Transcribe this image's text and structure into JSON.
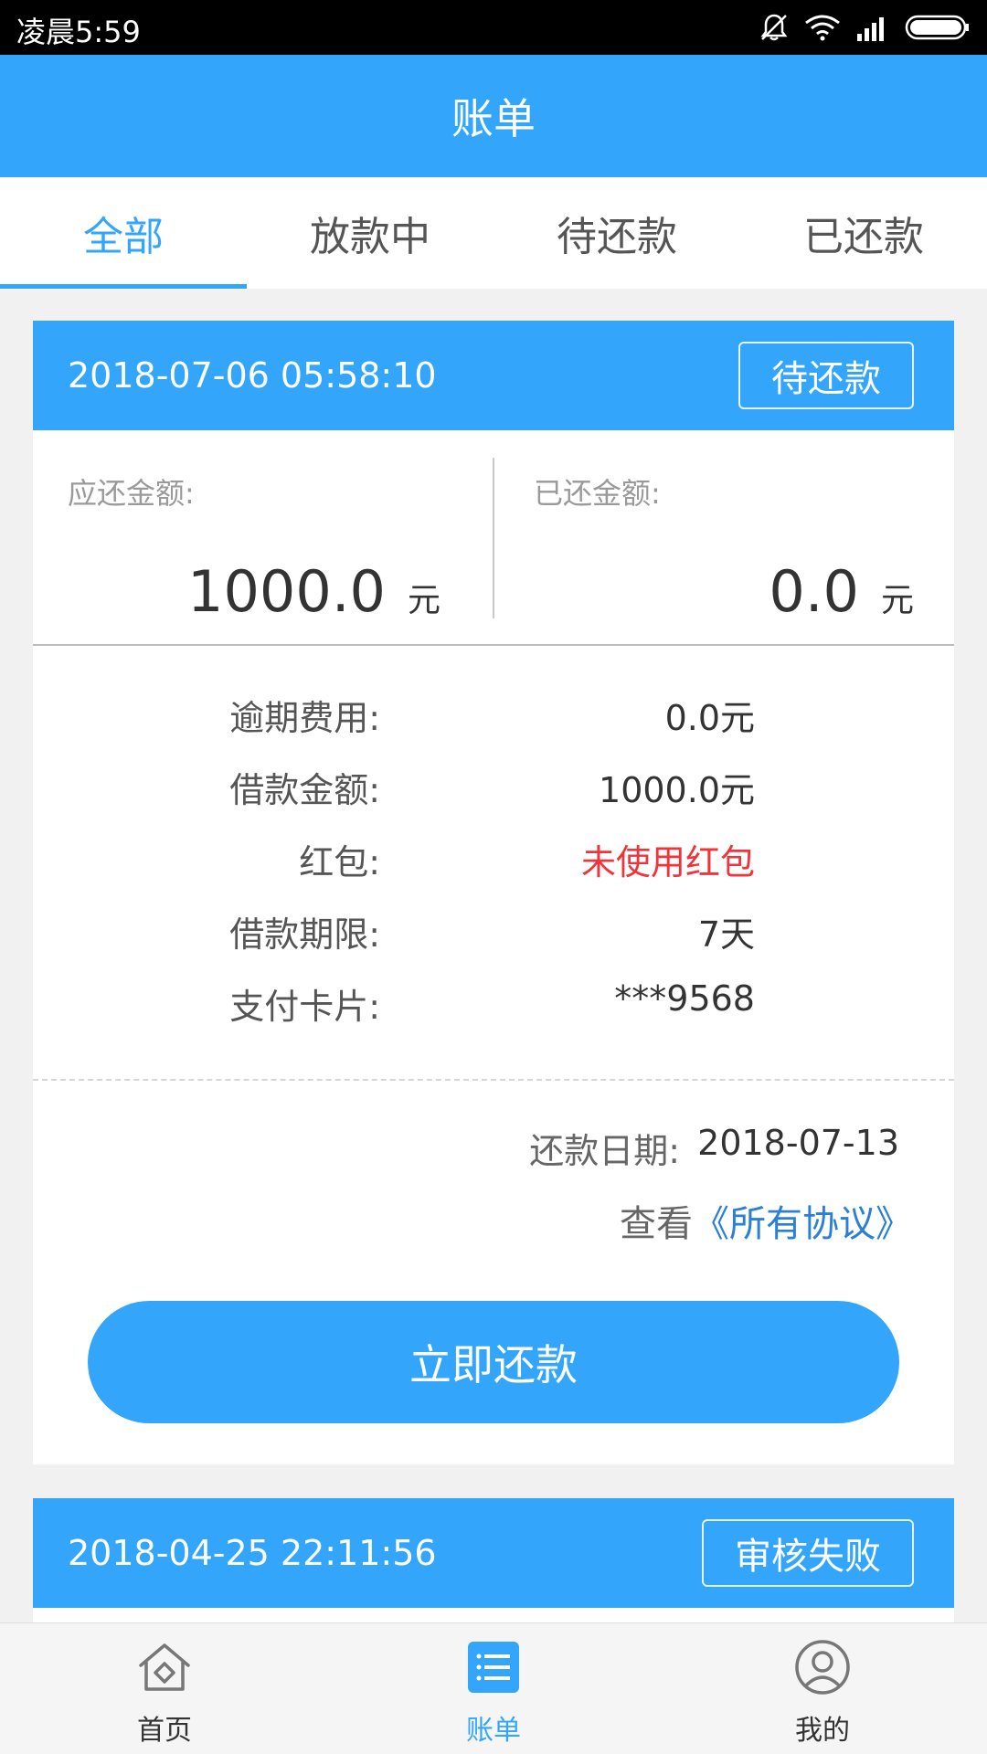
{
  "status_bar": {
    "time": "凌晨5:59",
    "icons": [
      "bell-muted-icon",
      "wifi-icon",
      "signal-icon",
      "battery-icon"
    ]
  },
  "header": {
    "title": "账单"
  },
  "tabs": [
    {
      "label": "全部",
      "active": true
    },
    {
      "label": "放款中",
      "active": false
    },
    {
      "label": "待还款",
      "active": false
    },
    {
      "label": "已还款",
      "active": false
    }
  ],
  "bills": [
    {
      "datetime": "2018-07-06 05:58:10",
      "status": "待还款",
      "due_label": "应还金额:",
      "due_amount": "1000.0",
      "paid_label": "已还金额:",
      "paid_amount": "0.0",
      "unit": "元",
      "details": [
        {
          "label": "逾期费用:",
          "value": "0.0元"
        },
        {
          "label": "借款金额:",
          "value": "1000.0元"
        },
        {
          "label": "红包:",
          "value": "未使用红包"
        },
        {
          "label": "借款期限:",
          "value": "7天"
        },
        {
          "label": "支付卡片:",
          "value": "***9568"
        }
      ],
      "repay_date_label": "还款日期:",
      "repay_date": "2018-07-13",
      "agreement_prefix": "查看",
      "agreement_link": "《所有协议》",
      "pay_button": "立即还款"
    },
    {
      "datetime": "2018-04-25 22:11:56",
      "status": "审核失败"
    }
  ],
  "bottom_nav": [
    {
      "label": "首页",
      "icon": "home-icon",
      "active": false
    },
    {
      "label": "账单",
      "icon": "bill-list-icon",
      "active": true
    },
    {
      "label": "我的",
      "icon": "profile-icon",
      "active": false
    }
  ],
  "colors": {
    "primary": "#33a6fb",
    "red": "#f0343a",
    "link": "#2b80d6"
  }
}
